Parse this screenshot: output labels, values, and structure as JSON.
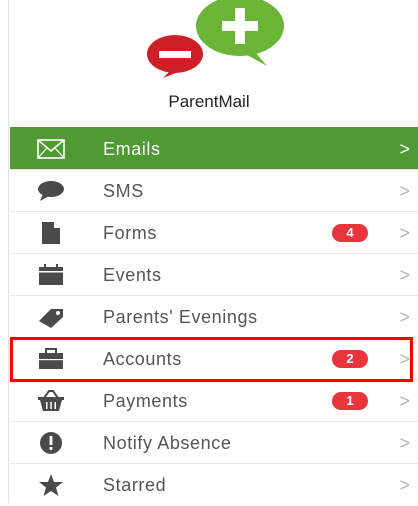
{
  "app": {
    "name": "ParentMail"
  },
  "colors": {
    "brand_green": "#6bb536",
    "active_bg": "#4f9a32",
    "brand_red": "#cc2027",
    "badge_red": "#e8353b",
    "highlight": "#ff0000",
    "icon_gray": "#4a4a4a"
  },
  "menu": {
    "items": [
      {
        "label": "Emails",
        "icon": "envelope-icon",
        "active": true,
        "badge": ""
      },
      {
        "label": "SMS",
        "icon": "speech-bubble-icon",
        "badge": ""
      },
      {
        "label": "Forms",
        "icon": "document-icon",
        "badge": "4"
      },
      {
        "label": "Events",
        "icon": "calendar-icon",
        "badge": ""
      },
      {
        "label": "Parents' Evenings",
        "icon": "tag-icon",
        "badge": ""
      },
      {
        "label": "Accounts",
        "icon": "briefcase-icon",
        "badge": "2",
        "highlighted": true
      },
      {
        "label": "Payments",
        "icon": "basket-icon",
        "badge": "1"
      },
      {
        "label": "Notify Absence",
        "icon": "exclamation-icon",
        "badge": ""
      },
      {
        "label": "Starred",
        "icon": "star-icon",
        "badge": ""
      }
    ],
    "chevron": ">"
  }
}
